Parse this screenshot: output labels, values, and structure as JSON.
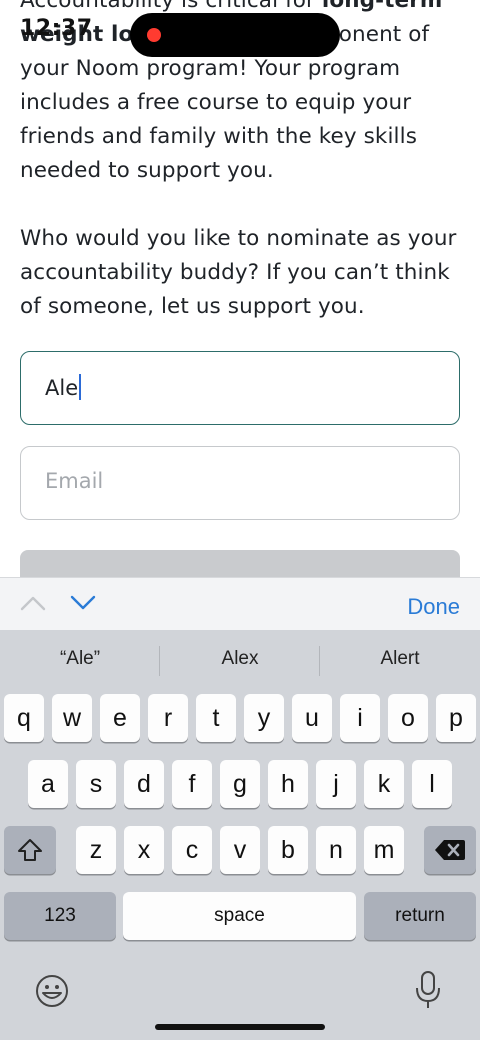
{
  "status": {
    "time": "12:37",
    "right": ""
  },
  "content": {
    "para1_part1": "Accountability is critical for ",
    "para1_bold": "long-term weight loss",
    "para1_part2": " and a key component of your Noom program! Your program includes a free course to equip your friends and family with the key skills needed to support you.",
    "para2": "Who would you like to nominate as your accountability buddy? If you can’t think of someone, let us support you."
  },
  "form": {
    "name_value": "Ale",
    "email_placeholder": "Email"
  },
  "accessory": {
    "done_label": "Done"
  },
  "keyboard": {
    "suggestions": [
      "“Ale”",
      "Alex",
      "Alert"
    ],
    "row1": [
      "q",
      "w",
      "e",
      "r",
      "t",
      "y",
      "u",
      "i",
      "o",
      "p"
    ],
    "row2": [
      "a",
      "s",
      "d",
      "f",
      "g",
      "h",
      "j",
      "k",
      "l"
    ],
    "row3": [
      "z",
      "x",
      "c",
      "v",
      "b",
      "n",
      "m"
    ],
    "numbers_label": "123",
    "space_label": "space",
    "return_label": "return"
  },
  "colors": {
    "active_border": "#2d6d6a",
    "accent": "#2a7bd6",
    "keyboard_bg": "#d1d4d9"
  }
}
